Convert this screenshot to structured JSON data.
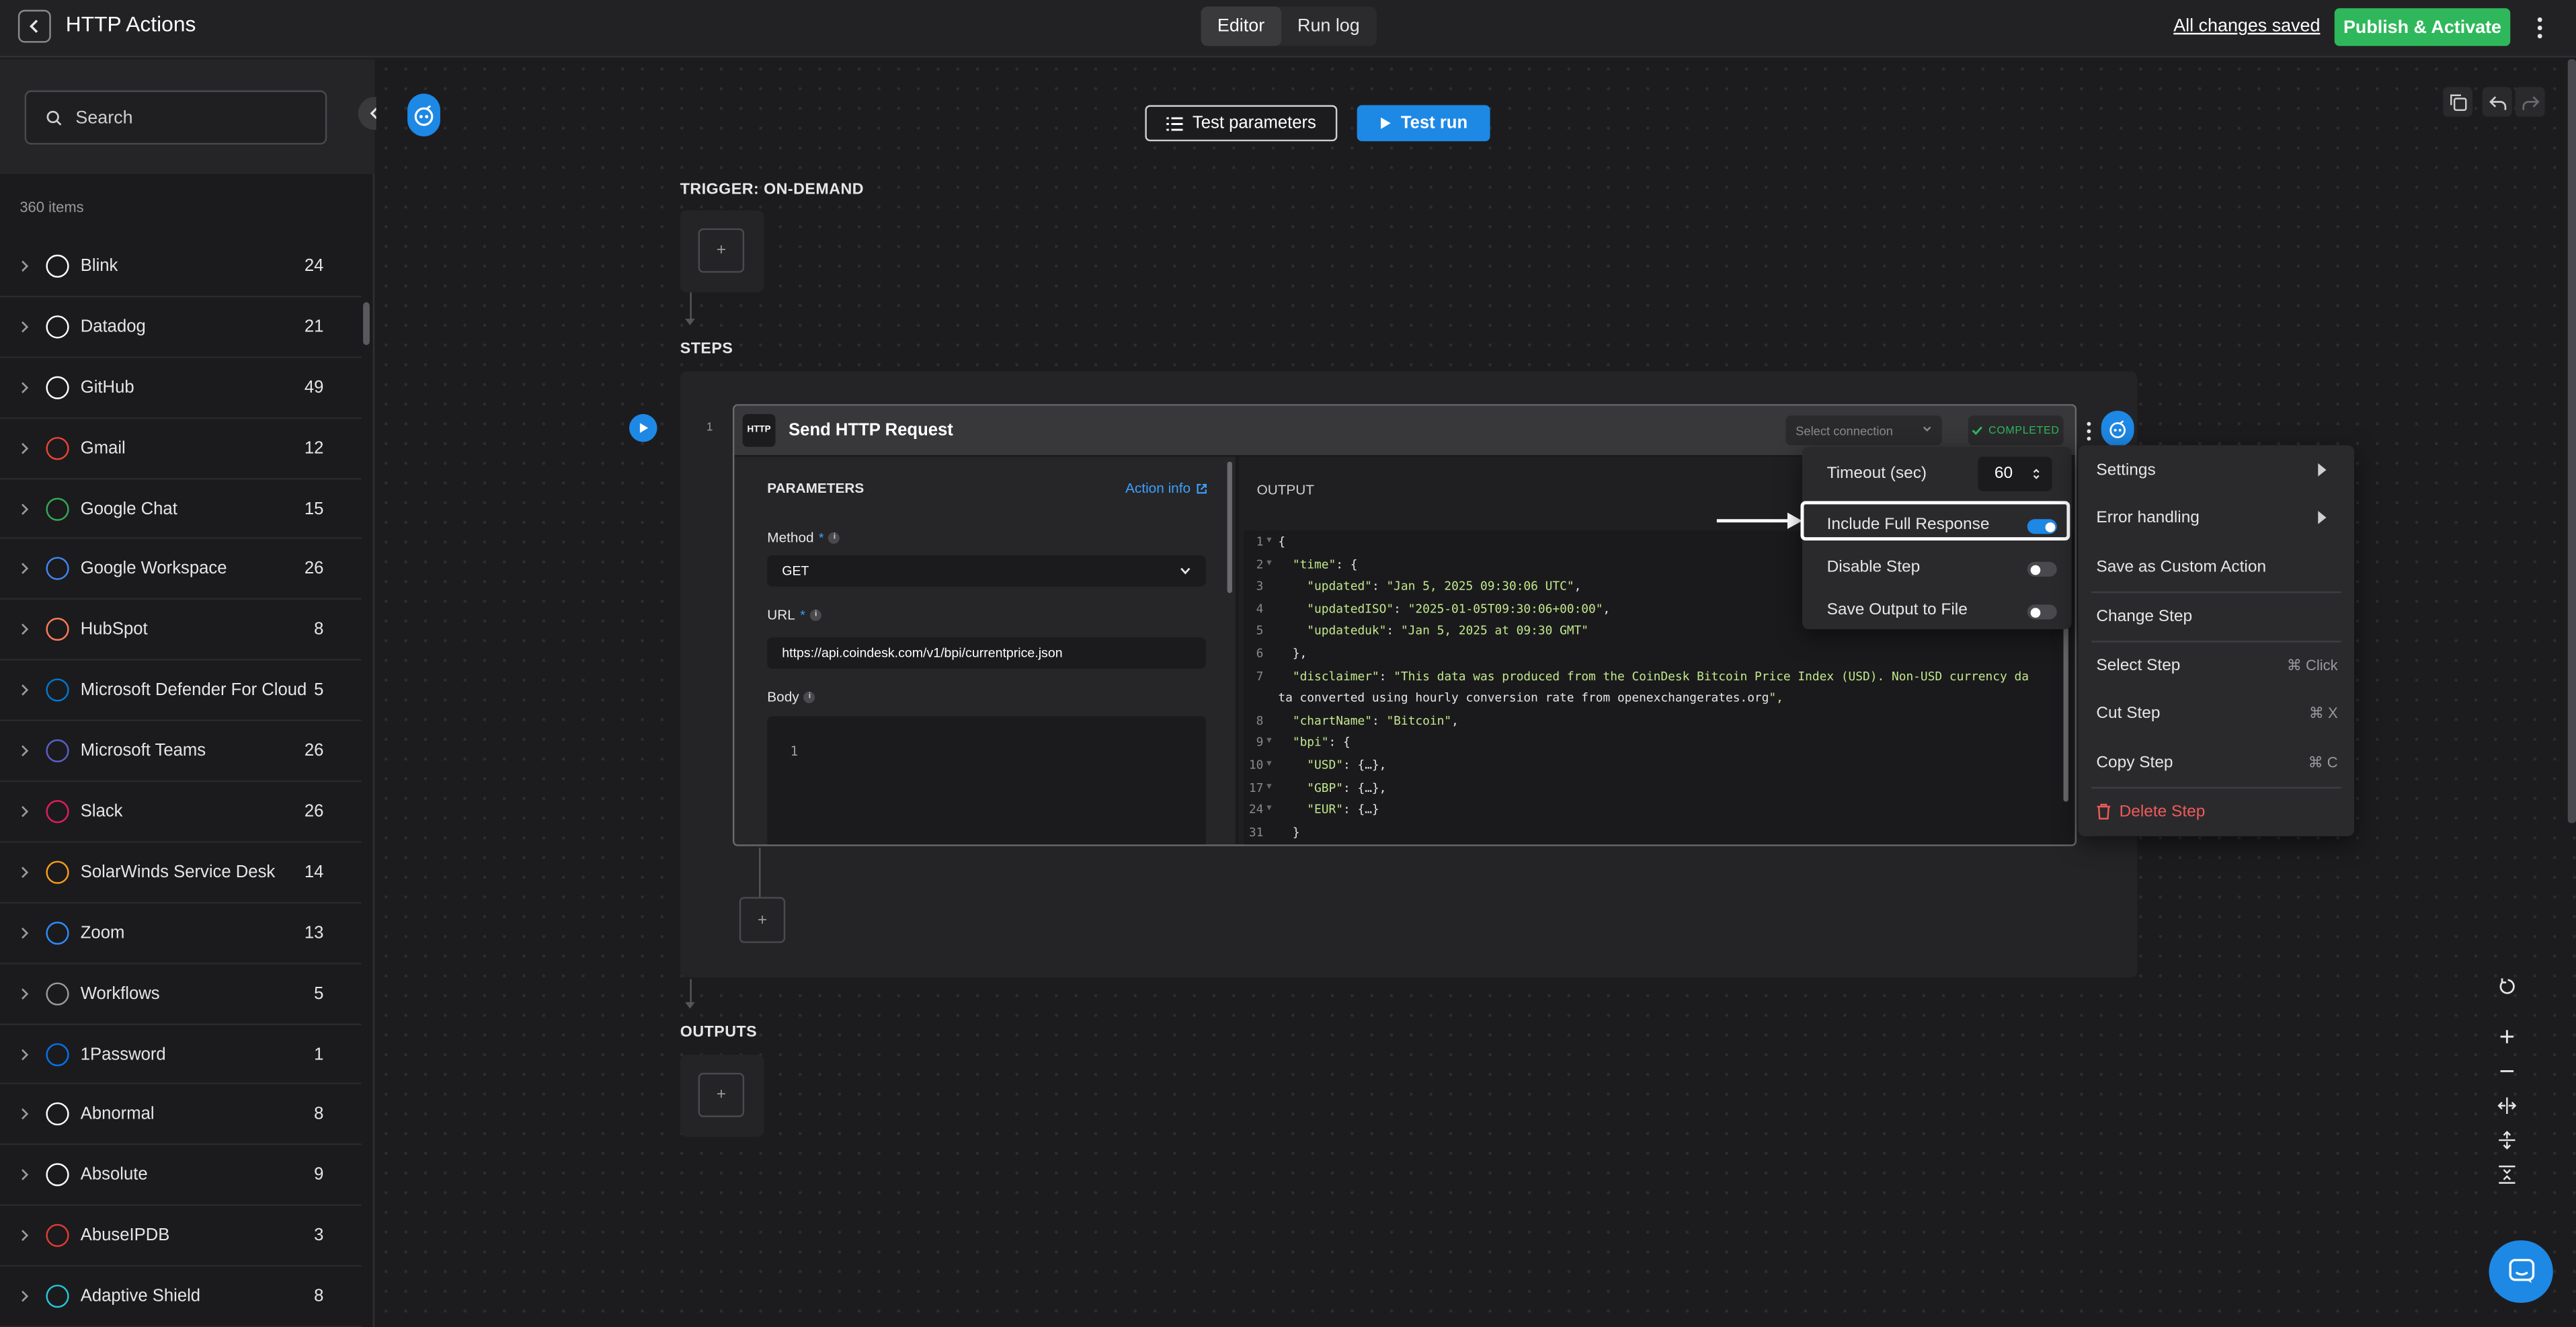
{
  "topbar": {
    "title": "HTTP Actions",
    "tabs": [
      {
        "label": "Editor",
        "active": true
      },
      {
        "label": "Run log",
        "active": false
      }
    ],
    "save_status": "All changes saved",
    "publish_label": "Publish & Activate"
  },
  "sidebar": {
    "search_placeholder": "Search",
    "count_label": "360 items",
    "items": [
      {
        "name": "Blink",
        "count": "24",
        "icon": "blink-icon",
        "color": "#ffffff"
      },
      {
        "name": "Datadog",
        "count": "21",
        "icon": "datadog-icon",
        "color": "#ffffff"
      },
      {
        "name": "GitHub",
        "count": "49",
        "icon": "github-icon",
        "color": "#ffffff"
      },
      {
        "name": "Gmail",
        "count": "12",
        "icon": "gmail-icon",
        "color": "#ea4335"
      },
      {
        "name": "Google Chat",
        "count": "15",
        "icon": "google-chat-icon",
        "color": "#34a853"
      },
      {
        "name": "Google Workspace",
        "count": "26",
        "icon": "google-icon",
        "color": "#4285f4"
      },
      {
        "name": "HubSpot",
        "count": "8",
        "icon": "hubspot-icon",
        "color": "#ff7a59"
      },
      {
        "name": "Microsoft Defender For Cloud",
        "count": "5",
        "icon": "shield-icon",
        "color": "#0078d4"
      },
      {
        "name": "Microsoft Teams",
        "count": "26",
        "icon": "teams-icon",
        "color": "#5b5fc7"
      },
      {
        "name": "Slack",
        "count": "26",
        "icon": "slack-icon",
        "color": "#e01e5a"
      },
      {
        "name": "SolarWinds Service Desk",
        "count": "14",
        "icon": "solarwinds-icon",
        "color": "#f99d1c"
      },
      {
        "name": "Zoom",
        "count": "13",
        "icon": "zoom-icon",
        "color": "#2d8cff"
      },
      {
        "name": "Workflows",
        "count": "5",
        "icon": "workflows-icon",
        "color": "#9a9a9e"
      },
      {
        "name": "1Password",
        "count": "1",
        "icon": "1password-icon",
        "color": "#0572ec"
      },
      {
        "name": "Abnormal",
        "count": "8",
        "icon": "abnormal-icon",
        "color": "#ffffff"
      },
      {
        "name": "Absolute",
        "count": "9",
        "icon": "absolute-icon",
        "color": "#ffffff"
      },
      {
        "name": "AbuseIPDB",
        "count": "3",
        "icon": "abuseipdb-icon",
        "color": "#e53935"
      },
      {
        "name": "Adaptive Shield",
        "count": "8",
        "icon": "adaptive-shield-icon",
        "color": "#26c6da"
      }
    ]
  },
  "canvas": {
    "test_params_label": "Test parameters",
    "test_run_label": "Test run",
    "trigger_label": "TRIGGER: ON-DEMAND",
    "steps_label": "STEPS",
    "outputs_label": "OUTPUTS",
    "add_glyph": "+"
  },
  "step": {
    "number": "1",
    "icon_text": "HTTP",
    "title": "Send HTTP Request",
    "connection_placeholder": "Select connection",
    "status": "COMPLETED",
    "params_title": "PARAMETERS",
    "action_info": "Action info",
    "method_label": "Method",
    "method_value": "GET",
    "url_label": "URL",
    "url_value": "https://api.coindesk.com/v1/bpi/currentprice.json",
    "body_label": "Body",
    "body_line_no": "1",
    "output_title": "OUTPUT",
    "output_lines": [
      {
        "n": "1",
        "fold": true,
        "t": "{"
      },
      {
        "n": "2",
        "fold": true,
        "t": "  \"time\": {"
      },
      {
        "n": "3",
        "fold": false,
        "t": "    \"updated\": \"Jan 5, 2025 09:30:06 UTC\","
      },
      {
        "n": "4",
        "fold": false,
        "t": "    \"updatedISO\": \"2025-01-05T09:30:06+00:00\","
      },
      {
        "n": "5",
        "fold": false,
        "t": "    \"updateduk\": \"Jan 5, 2025 at 09:30 GMT\""
      },
      {
        "n": "6",
        "fold": false,
        "t": "  },"
      },
      {
        "n": "7",
        "fold": false,
        "t": "  \"disclaimer\": \"This data was produced from the CoinDesk Bitcoin Price Index (USD). Non-USD currency da"
      },
      {
        "n": "",
        "fold": false,
        "t": "ta converted using hourly conversion rate from openexchangerates.org\","
      },
      {
        "n": "8",
        "fold": false,
        "t": "  \"chartName\": \"Bitcoin\","
      },
      {
        "n": "9",
        "fold": true,
        "t": "  \"bpi\": {"
      },
      {
        "n": "10",
        "fold": true,
        "t": "    \"USD\": {…},"
      },
      {
        "n": "17",
        "fold": true,
        "t": "    \"GBP\": {…},"
      },
      {
        "n": "24",
        "fold": true,
        "t": "    \"EUR\": {…}"
      },
      {
        "n": "31",
        "fold": false,
        "t": "  }"
      }
    ]
  },
  "settings_submenu": {
    "timeout_label": "Timeout (sec)",
    "timeout_value": "60",
    "include_full_response": {
      "label": "Include Full Response",
      "on": true
    },
    "disable_step": {
      "label": "Disable Step",
      "on": false
    },
    "save_output": {
      "label": "Save Output to File",
      "on": false
    }
  },
  "context_menu": {
    "settings": "Settings",
    "error_handling": "Error handling",
    "save_custom": "Save as Custom Action",
    "change_step": "Change Step",
    "select_step": "Select Step",
    "select_shortcut": "⌘ Click",
    "cut_step": "Cut Step",
    "cut_shortcut": "⌘ X",
    "copy_step": "Copy Step",
    "copy_shortcut": "⌘ C",
    "delete_step": "Delete Step",
    "delete_color": "#f05a5a"
  }
}
